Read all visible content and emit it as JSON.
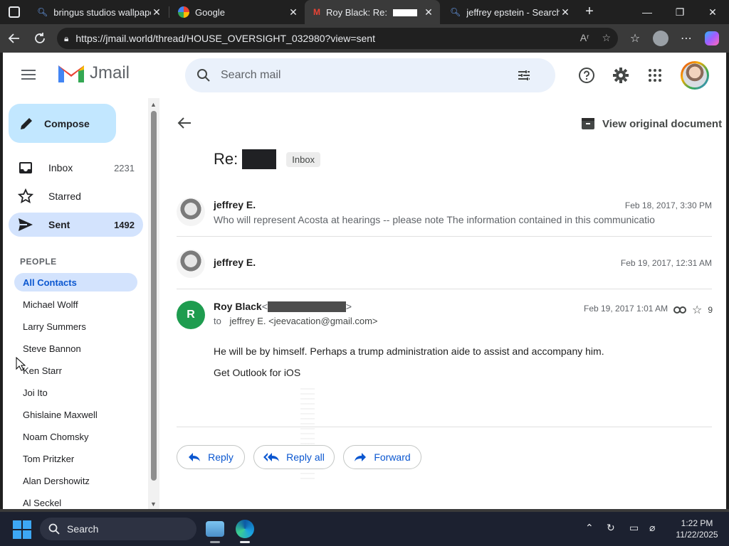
{
  "browser": {
    "tabs": [
      {
        "title": "bringus studios wallpape",
        "icon": "search-icon",
        "active": false
      },
      {
        "title": "Google",
        "icon": "google-icon",
        "active": false
      },
      {
        "title": "Roy Black: Re:",
        "icon": "gmail-icon",
        "active": true
      },
      {
        "title": "jeffrey epstein - Search",
        "icon": "search-icon",
        "active": false
      }
    ],
    "url": "https://jmail.world/thread/HOUSE_OVERSIGHT_032980?view=sent"
  },
  "app": {
    "name": "Jmail",
    "search_placeholder": "Search mail"
  },
  "sidebar": {
    "compose_label": "Compose",
    "items": [
      {
        "label": "Inbox",
        "count": "2231",
        "icon": "inbox-icon"
      },
      {
        "label": "Starred",
        "count": "",
        "icon": "star-icon"
      },
      {
        "label": "Sent",
        "count": "1492",
        "icon": "send-icon",
        "active": true
      }
    ],
    "people_header": "PEOPLE",
    "contacts": [
      "All Contacts",
      "Michael Wolff",
      "Larry Summers",
      "Steve Bannon",
      "Ken Starr",
      "Joi Ito",
      "Ghislaine Maxwell",
      "Noam Chomsky",
      "Tom Pritzker",
      "Alan Dershowitz",
      "Al Seckel"
    ]
  },
  "thread": {
    "view_original_label": "View original document",
    "subject_prefix": "Re:",
    "label_chip": "Inbox",
    "messages": [
      {
        "sender": "jeffrey E.",
        "date": "Feb 18, 2017, 3:30 PM",
        "snippet": "Who will represent Acosta at hearings -- please note The information contained in this communicatio"
      },
      {
        "sender": "jeffrey E.",
        "date": "Feb 19, 2017, 12:31 AM",
        "snippet": ""
      }
    ],
    "expanded": {
      "avatar_letter": "R",
      "sender": "Roy Black",
      "to_word": "to",
      "to": "jeffrey E. <jeevacation@gmail.com>",
      "date": "Feb 19, 2017 1:01 AM",
      "attachment_count": "9",
      "body": [
        "He will be by himself. Perhaps a trump administration aide to assist and accompany him.",
        "Get Outlook for iOS"
      ]
    },
    "actions": {
      "reply": "Reply",
      "reply_all": "Reply all",
      "forward": "Forward"
    }
  },
  "taskbar": {
    "search_label": "Search",
    "time": "1:22 PM",
    "date": "11/22/2025"
  },
  "colors": {
    "accent_blue": "#0b57d0",
    "compose_bg": "#c2e7ff",
    "active_nav": "#d3e3fd",
    "avatar_green": "#1e9c4f"
  }
}
